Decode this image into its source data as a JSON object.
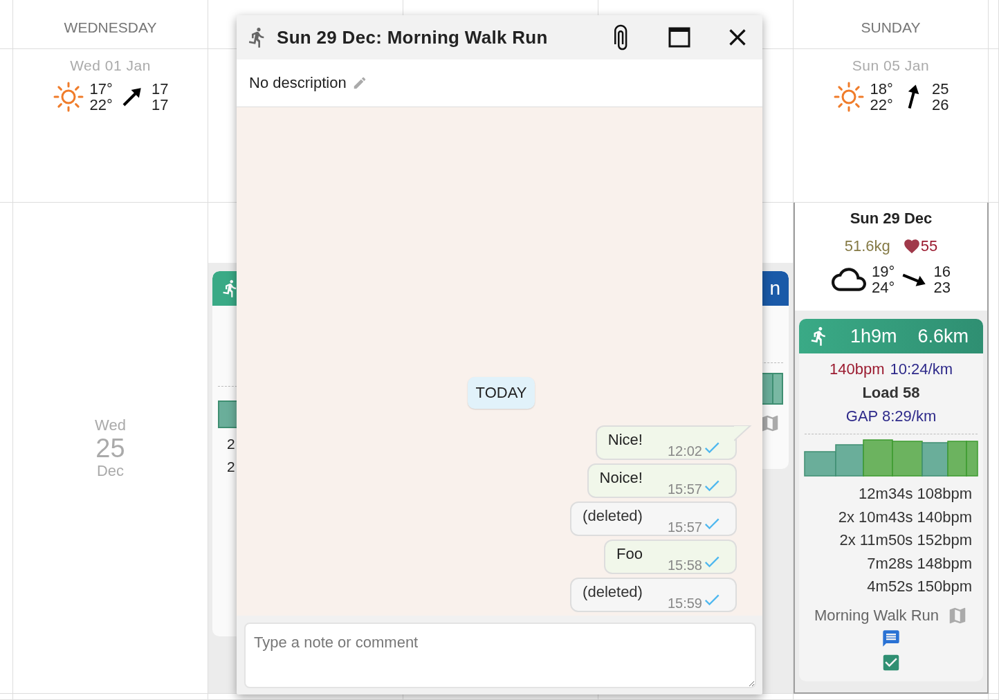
{
  "calendar": {
    "headings": [
      {
        "label": "WEDNESDAY"
      },
      {
        "label": "SUNDAY"
      }
    ],
    "next_week": [
      {
        "date": "Wed 01 Jan",
        "weather": {
          "kind": "sun",
          "low": "17°",
          "high": "22°",
          "arrow": {
            "kind": "ne"
          },
          "wind": [
            "17",
            "17"
          ]
        }
      },
      {
        "date": "Sun 05 Jan",
        "weather": {
          "kind": "sun",
          "low": "18°",
          "high": "22°",
          "arrow": {
            "kind": "nne"
          },
          "wind": [
            "25",
            "26"
          ]
        }
      }
    ],
    "wednesday": {
      "weekday": "Wed",
      "day": "25",
      "month": "Dec"
    },
    "thursday_card": {
      "lines": [
        "2",
        "2"
      ]
    },
    "saturday_card": {
      "title": "n"
    },
    "sunday": {
      "date": "Sun 29 Dec",
      "weight": "51.6kg",
      "resting_hr": "55",
      "weather": {
        "kind": "cloud",
        "low": "19°",
        "high": "24°",
        "arrow": {
          "kind": "ese"
        },
        "wind": [
          "16",
          "23"
        ]
      },
      "activity": {
        "duration": "1h9m",
        "distance": "6.6km",
        "heart_rate": "140bpm",
        "pace": "10:24/km",
        "load": "Load 58",
        "gap": "GAP 8:29/km",
        "laps": [
          "12m34s 108bpm",
          "2x 10m43s 140bpm",
          "2x 11m50s 152bpm",
          "7m28s 148bpm",
          "4m52s 150bpm"
        ],
        "name": "Morning Walk Run",
        "has_comments": true,
        "completed": true
      }
    }
  },
  "dialog": {
    "title": "Sun 29 Dec: Morning Walk Run",
    "description": "No description",
    "day_chip": "TODAY",
    "messages": [
      {
        "text": "Nice!",
        "time": "12:02",
        "deleted": false
      },
      {
        "text": "Noice!",
        "time": "15:57",
        "deleted": false
      },
      {
        "text": "(deleted)",
        "time": "15:57",
        "deleted": true
      },
      {
        "text": "Foo",
        "time": "15:58",
        "deleted": false
      },
      {
        "text": "(deleted)",
        "time": "15:59",
        "deleted": true
      }
    ],
    "comment_placeholder": "Type a note or comment"
  }
}
